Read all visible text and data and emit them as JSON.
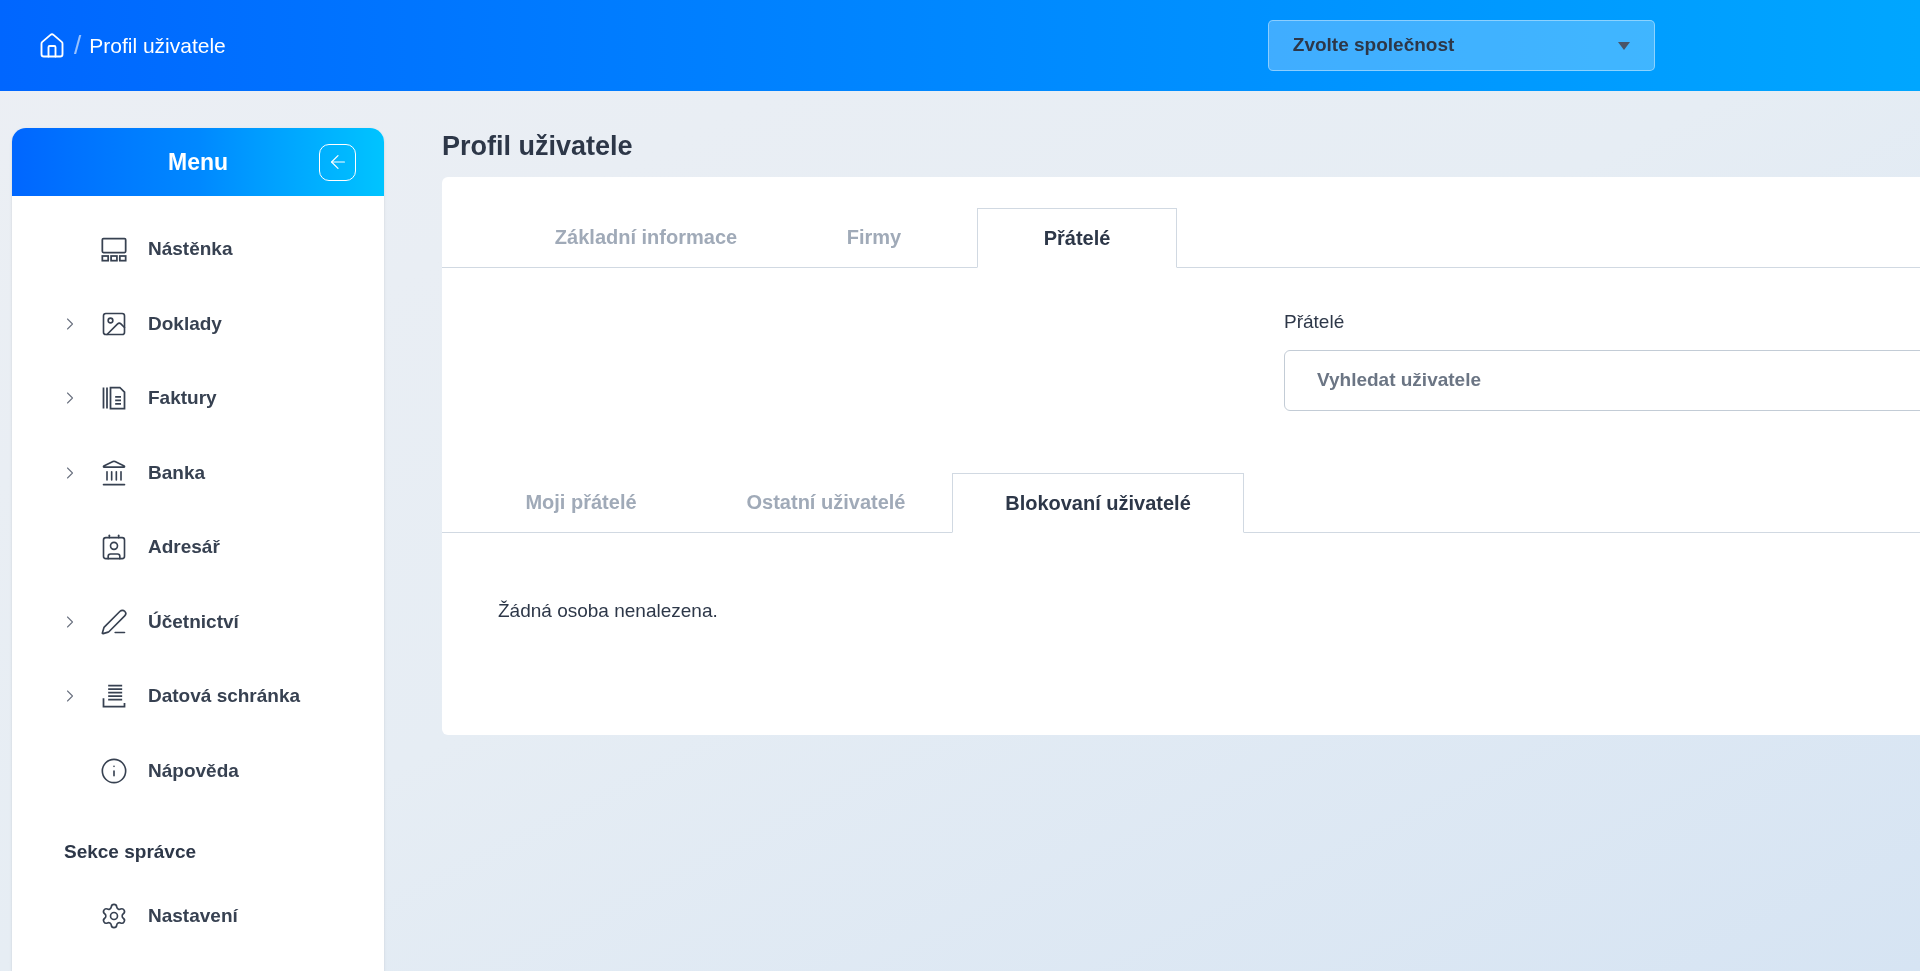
{
  "breadcrumb": {
    "separator": "/",
    "current": "Profil uživatele"
  },
  "company_select": {
    "placeholder": "Zvolte společnost"
  },
  "sidebar": {
    "title": "Menu",
    "items": [
      {
        "label": "Nástěnka",
        "kind": "link"
      },
      {
        "label": "Doklady",
        "kind": "group"
      },
      {
        "label": "Faktury",
        "kind": "group"
      },
      {
        "label": "Banka",
        "kind": "group"
      },
      {
        "label": "Adresář",
        "kind": "link"
      },
      {
        "label": "Účetnictví",
        "kind": "group"
      },
      {
        "label": "Datová schránka",
        "kind": "group"
      },
      {
        "label": "Nápověda",
        "kind": "link"
      }
    ],
    "admin_section": {
      "title": "Sekce správce",
      "items": [
        {
          "label": "Nastavení"
        }
      ]
    }
  },
  "page_title": "Profil uživatele",
  "tabs": [
    {
      "label": "Základní informace",
      "selected": false
    },
    {
      "label": "Firmy",
      "selected": false
    },
    {
      "label": "Přátelé",
      "selected": true
    }
  ],
  "friends_search": {
    "label": "Přátelé",
    "placeholder": "Vyhledat uživatele"
  },
  "sub_tabs": [
    {
      "label": "Moji přátelé",
      "selected": false
    },
    {
      "label": "Ostatní uživatelé",
      "selected": false
    },
    {
      "label": "Blokovaní uživatelé",
      "selected": true
    }
  ],
  "empty_message": "Žádná osoba nenalezena."
}
